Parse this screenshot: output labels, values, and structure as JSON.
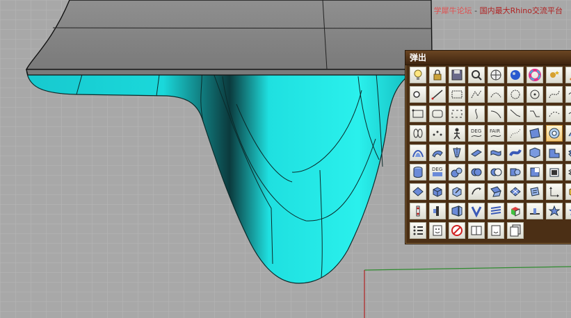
{
  "watermark": {
    "site": "学犀牛论坛",
    "separator": " - ",
    "slogan": "国内最大Rhino交流平台"
  },
  "colors": {
    "viewport_bg": "#a9a9a9",
    "grid_line": "#b8b8b8",
    "surface_cyan": "#1ee6e6",
    "surface_top": "#8c8c8c",
    "panel_bg": "#4b2f15",
    "axis_red": "#b22222",
    "axis_green": "#2e8b2e"
  },
  "toolbar": {
    "title": "弹出",
    "rows": [
      [
        "lightbulb-icon",
        "lock-icon",
        "save-icon",
        "zoom-window-icon",
        "render-sphere-icon",
        "shaded-sphere-icon",
        "color-wheel-icon",
        "gear-stars-icon",
        "pencil-icon",
        ""
      ],
      [
        "point-icon",
        "line-icon",
        "rectangle-icon",
        "polyline-icon",
        "arc-icon",
        "circle-icon",
        "circle-dot-icon",
        "curve-icon",
        "spline-icon",
        ""
      ],
      [
        "rectangle-points-icon",
        "rounded-rect-icon",
        "rect-corners-icon",
        "bracket-curve-icon",
        "curve-segment-icon",
        "curve-arrow-icon",
        "curve-step-icon",
        "curve-chain-icon",
        "curve-end-icon",
        ""
      ],
      [
        "cylinder-outline-icon",
        "curve-points-icon",
        "walker-icon",
        "deg-icon",
        "fair-icon",
        "sketch-curve-icon",
        "surface-patch-icon",
        "circle-target-icon",
        "surface-edge-icon",
        ""
      ],
      [
        "loft-icon",
        "sweep-icon",
        "revolve-icon",
        "surface-flat-icon",
        "surface-twist-icon",
        "surface-blend-icon",
        "surface-rail-icon",
        "surface-fold-icon",
        "surface-offset-icon",
        ""
      ],
      [
        "cylinder-icon",
        "deg-surface-icon",
        "spheres-icon",
        "boolean-union-icon",
        "boolean-diff-icon",
        "boolean-split-icon",
        "cut-solid-icon",
        "shell-icon",
        "layers-icon",
        ""
      ],
      [
        "plane-icon",
        "box-icon",
        "solid-edit-icon",
        "sweep-arrow-icon",
        "unroll-icon",
        "grid-surface-icon",
        "panel-icon",
        "dimension-icon",
        "box-color-icon",
        ""
      ],
      [
        "split-dots-icon",
        "split-bar-icon",
        "surface-split-icon",
        "surface-v-icon",
        "stripes-icon",
        "color-cube-icon",
        "plane-cut-icon",
        "star-dots-icon",
        "star-icon",
        ""
      ],
      [
        "dots-grid-icon",
        "face-icon",
        "no-face-icon",
        "face-pair-icon",
        "face-frame-icon",
        "face-copy-icon",
        "",
        "",
        "",
        ""
      ]
    ]
  }
}
